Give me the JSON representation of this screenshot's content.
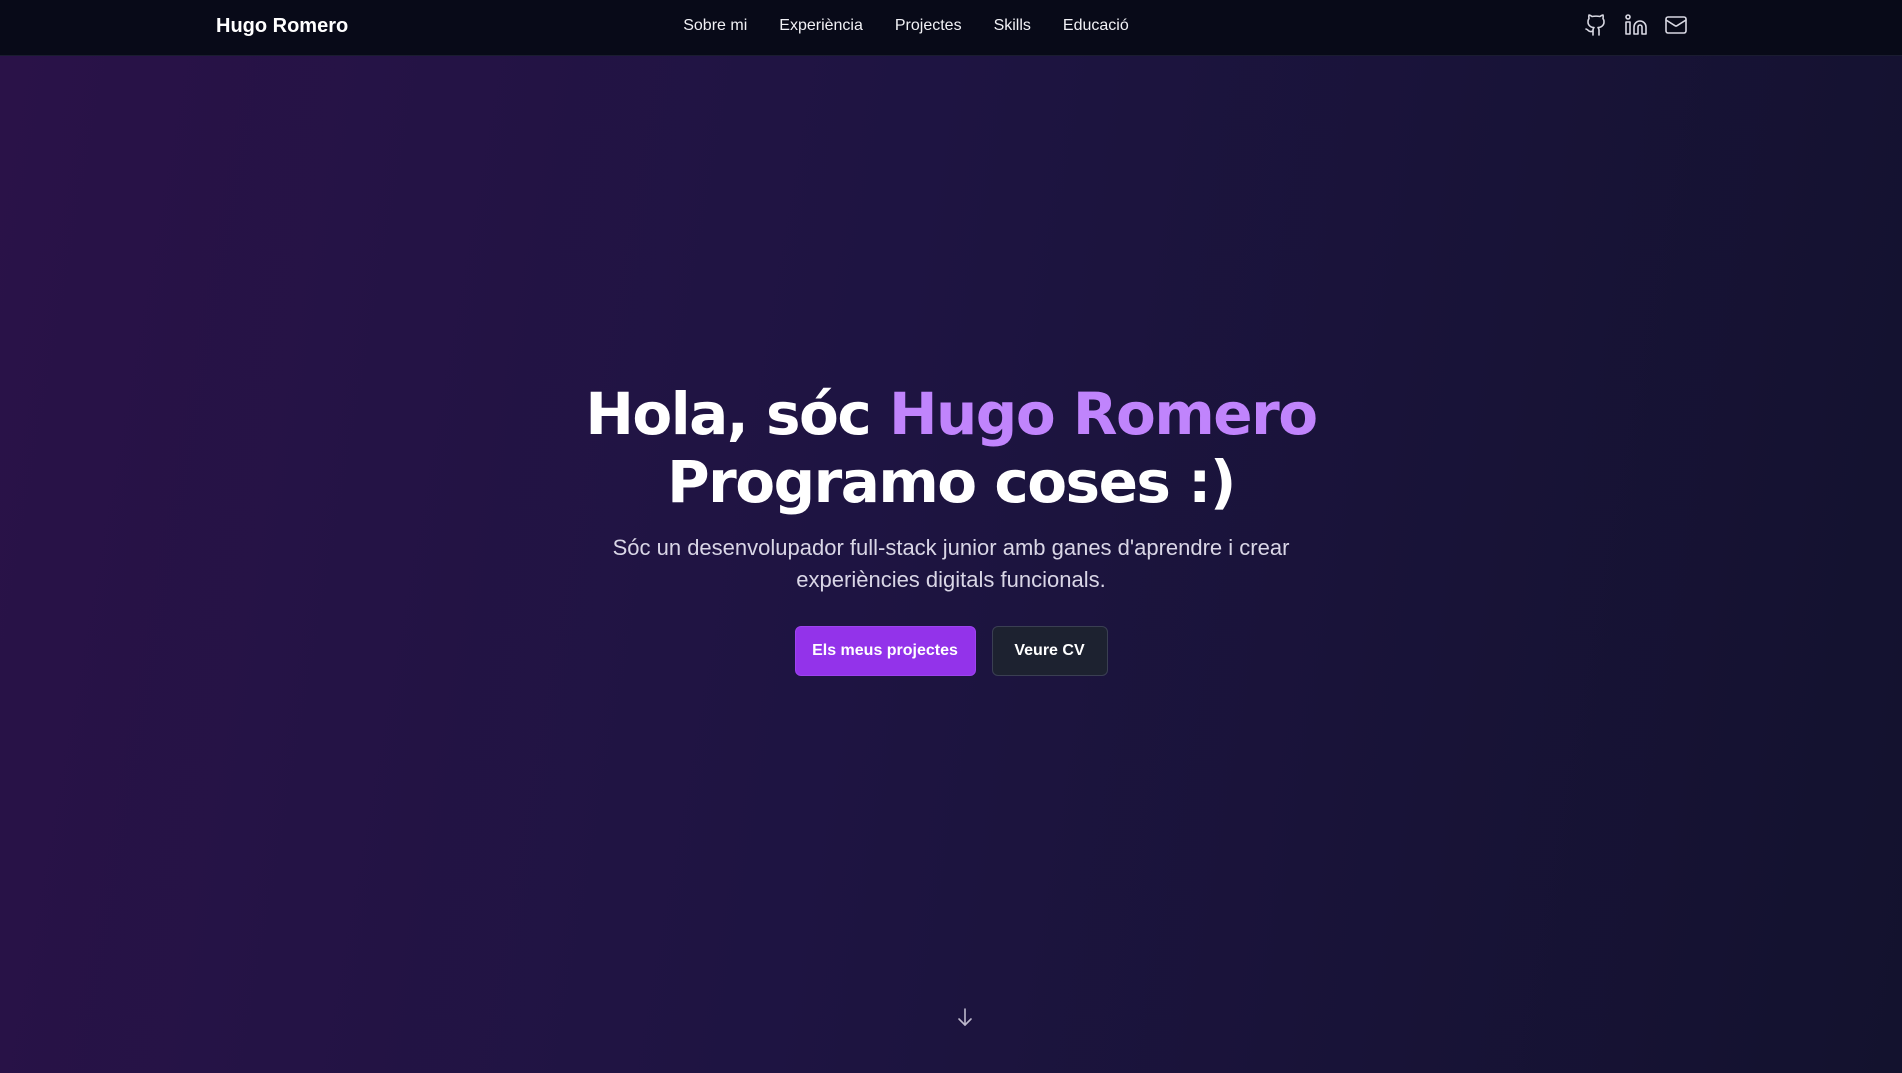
{
  "navbar": {
    "brand": "Hugo Romero",
    "links": [
      {
        "label": "Sobre mi"
      },
      {
        "label": "Experiència"
      },
      {
        "label": "Projectes"
      },
      {
        "label": "Skills"
      },
      {
        "label": "Educació"
      }
    ],
    "social_icons": [
      "github-icon",
      "linkedin-icon",
      "mail-icon"
    ]
  },
  "hero": {
    "greeting": "Hola, sóc ",
    "name": "Hugo Romero",
    "tagline": "Programo coses :)",
    "subtitle": "Sóc un desenvolupador full-stack junior amb ganes d'aprendre i crear experiències digitals funcionals.",
    "primary_button": "Els meus projectes",
    "secondary_button": "Veure CV"
  },
  "scroll_icon": "arrow-down-icon",
  "colors": {
    "accent": "#c084fc",
    "primary_button": "#9333ea",
    "navbar_bg": "#080a18",
    "secondary_button": "#1d2230"
  }
}
